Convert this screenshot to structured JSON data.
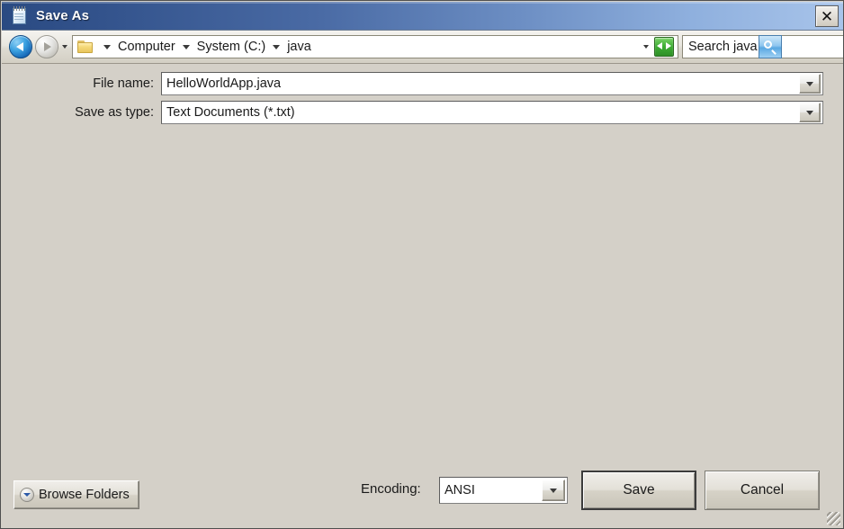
{
  "window": {
    "title": "Save As",
    "title_icon": "notepad-icon",
    "close_label": "✕",
    "bg_color": "#d4d0c8",
    "titlebar_gradient_from": "#2a4a82",
    "titlebar_gradient_to": "#a8c4ea"
  },
  "navbar": {
    "back_icon": "back-arrow-icon",
    "forward_icon": "forward-arrow-icon",
    "history_icon": "chevron-down-icon",
    "folder_icon": "folder-icon",
    "breadcrumbs": [
      {
        "label": "Computer"
      },
      {
        "label": "System (C:)"
      },
      {
        "label": "java"
      }
    ],
    "address_dropdown_icon": "chevron-down-icon",
    "refresh_icon": "refresh-icon",
    "search": {
      "value": "Search java",
      "placeholder": "Search java",
      "button_icon": "search-icon"
    }
  },
  "form": {
    "file_name": {
      "label": "File name:",
      "value": "HelloWorldApp.java",
      "dropdown_icon": "chevron-down-icon"
    },
    "save_as_type": {
      "label": "Save as type:",
      "value": "Text Documents (*.txt)",
      "dropdown_icon": "chevron-down-icon"
    }
  },
  "footer": {
    "browse_folders": {
      "label": "Browse Folders",
      "icon": "chevron-down-circle-icon"
    },
    "encoding": {
      "label": "Encoding:",
      "value": "ANSI",
      "dropdown_icon": "chevron-down-icon"
    },
    "save_button": "Save",
    "cancel_button": "Cancel",
    "resize_grip_icon": "resize-grip-icon"
  }
}
